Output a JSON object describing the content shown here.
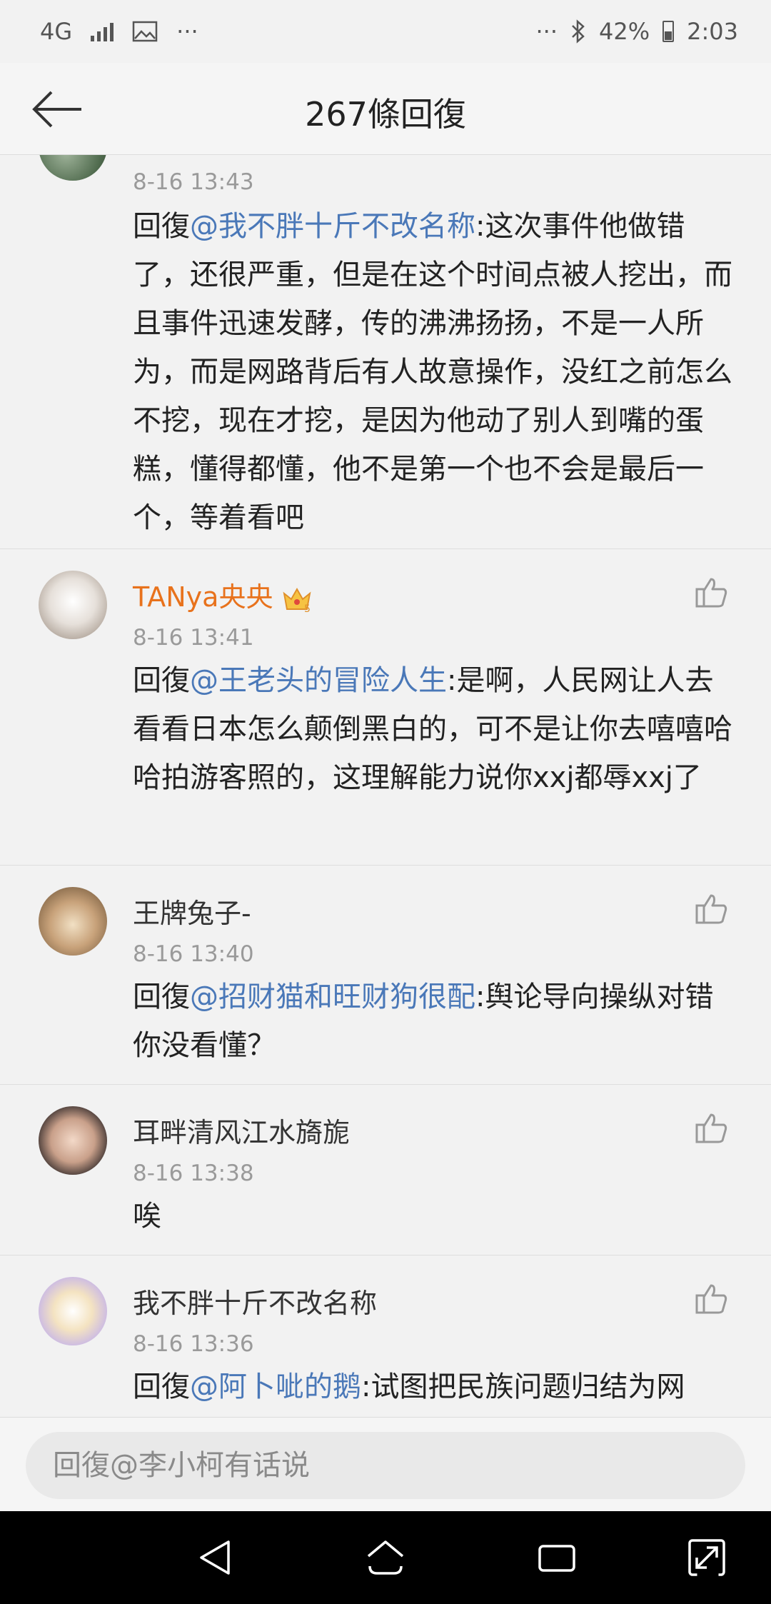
{
  "status_bar": {
    "network": "4G",
    "more_left": "···",
    "more_right": "···",
    "battery": "42%",
    "time": "2:03"
  },
  "header": {
    "title": "267條回復"
  },
  "comments": [
    {
      "username": "",
      "time": "8-16 13:43",
      "reply_prefix": "回復",
      "mention": "@我不胖十斤不改名称",
      "text": ":这次事件他做错了，还很严重，但是在这个时间点被人挖出，而且事件迅速发酵，传的沸沸扬扬，不是一人所为，而是网路背后有人故意操作，没红之前怎么不挖，现在才挖，是因为他动了别人到嘴的蛋糕，懂得都懂，他不是第一个也不会是最后一个，等着看吧"
    },
    {
      "username": "TANya央央",
      "badge": "5",
      "time": "8-16 13:41",
      "reply_prefix": "回復",
      "mention": "@王老头的冒险人生",
      "text": ":是啊，人民网让人去看看日本怎么颠倒黑白的，可不是让你去嘻嘻哈哈拍游客照的，这理解能力说你xxj都辱xxj了"
    },
    {
      "username": "王牌兔子-",
      "time": "8-16 13:40",
      "reply_prefix": "回復",
      "mention": "@招财猫和旺财狗很配",
      "text": ":舆论导向操纵对错你没看懂？"
    },
    {
      "username": "耳畔清风江水旖旎",
      "time": "8-16 13:38",
      "text": "唉"
    },
    {
      "username": "我不胖十斤不改名称",
      "time": "8-16 13:36",
      "reply_prefix": "回復",
      "mention": "@阿卜呲的鹅",
      "text": ":试图把民族问题归结为网"
    }
  ],
  "input": {
    "placeholder": "回復@李小柯有话说"
  },
  "colors": {
    "mention": "#4a78b8",
    "vip_name": "#e8721c",
    "background": "#f2f2f2"
  },
  "icons": [
    "back-arrow-icon",
    "thumbs-up-icon",
    "crown-badge-icon",
    "nav-back-icon",
    "nav-home-icon",
    "nav-recents-icon",
    "nav-expand-icon"
  ]
}
